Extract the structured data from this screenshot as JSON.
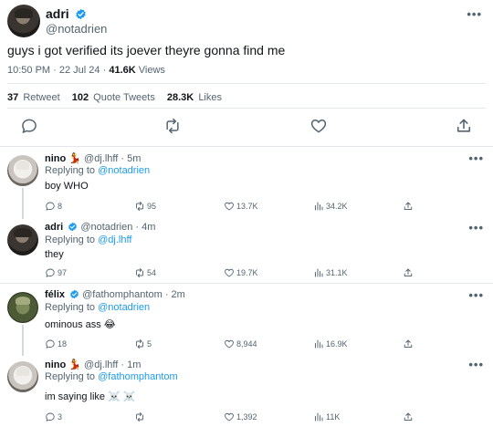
{
  "main": {
    "name": "adri",
    "handle": "@notadrien",
    "text": "guys i got verified its joever theyre gonna find me",
    "time": "10:50 PM",
    "date": "22 Jul 24",
    "views_count": "41.6K",
    "views_label": "Views",
    "retweets_count": "37",
    "retweets_label": "Retweet",
    "quotes_count": "102",
    "quotes_label": "Quote Tweets",
    "likes_count": "28.3K",
    "likes_label": "Likes",
    "more": "•••"
  },
  "replies": [
    {
      "name": "nino 💃",
      "handle": "@dj.lhff",
      "time": "5m",
      "replying_label": "Replying to",
      "replying_to": "@notadrien",
      "text": "boy WHO",
      "replies": "8",
      "retweets": "95",
      "likes": "13.7K",
      "views": "34.2K",
      "more": "•••"
    },
    {
      "name": "adri",
      "handle": "@notadrien",
      "time": "4m",
      "replying_label": "Replying to",
      "replying_to": "@dj.lhff",
      "text": "they",
      "replies": "97",
      "retweets": "54",
      "likes": "19.7K",
      "views": "31.1K",
      "more": "•••"
    },
    {
      "name": "félix",
      "handle": "@fathomphantom",
      "time": "2m",
      "replying_label": "Replying to",
      "replying_to": "@notadrien",
      "text": "ominous ass 😂",
      "replies": "18",
      "retweets": "5",
      "likes": "8,944",
      "views": "16.9K",
      "more": "•••"
    },
    {
      "name": "nino 💃",
      "handle": "@dj.lhff",
      "time": "1m",
      "replying_label": "Replying to",
      "replying_to": "@fathomphantom",
      "text": "im saying like ☠️ ☠️",
      "replies": "3",
      "retweets": "",
      "likes": "1,392",
      "views": "11K",
      "more": "•••"
    }
  ],
  "colors": {
    "accent": "#1d9bf0",
    "text": "#0f1419",
    "muted": "#536471",
    "divider": "#e3e7ea"
  },
  "icons": [
    "verified-icon",
    "reply-icon",
    "retweet-icon",
    "like-icon",
    "views-icon",
    "share-icon",
    "more-icon"
  ]
}
